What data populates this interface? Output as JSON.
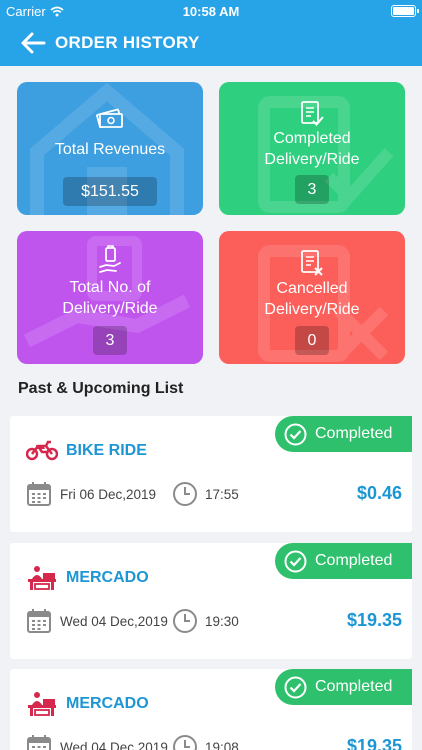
{
  "status_bar": {
    "carrier": "Carrier",
    "time": "10:58 AM"
  },
  "header": {
    "title": "ORDER HISTORY"
  },
  "tiles": {
    "revenue": {
      "label": "Total Revenues",
      "value": "$151.55",
      "color": "#3d9ee0"
    },
    "completed": {
      "label": "Completed Delivery/Ride",
      "value": "3",
      "color": "#2ecf7e"
    },
    "total": {
      "label": "Total No. of Delivery/Ride",
      "value": "3",
      "color": "#c055ee"
    },
    "cancelled": {
      "label": "Cancelled Delivery/Ride",
      "value": "0",
      "color": "#fc5e5a"
    }
  },
  "section": {
    "title": "Past & Upcoming List"
  },
  "orders": [
    {
      "type": "BIKE RIDE",
      "icon": "motorbike-icon",
      "date": "Fri 06 Dec,2019",
      "time": "17:55",
      "amount": "$0.46",
      "status": "Completed"
    },
    {
      "type": "MERCADO",
      "icon": "market-stall-icon",
      "date": "Wed 04 Dec,2019",
      "time": "19:30",
      "amount": "$19.35",
      "status": "Completed"
    },
    {
      "type": "MERCADO",
      "icon": "market-stall-icon",
      "date": "Wed 04 Dec,2019",
      "time": "19:08",
      "amount": "$19.35",
      "status": "Completed"
    }
  ],
  "colors": {
    "header": "#27a3e8",
    "accent": "#1d96d3",
    "status_completed": "#2ec06c",
    "icon_red": "#d6284d"
  }
}
